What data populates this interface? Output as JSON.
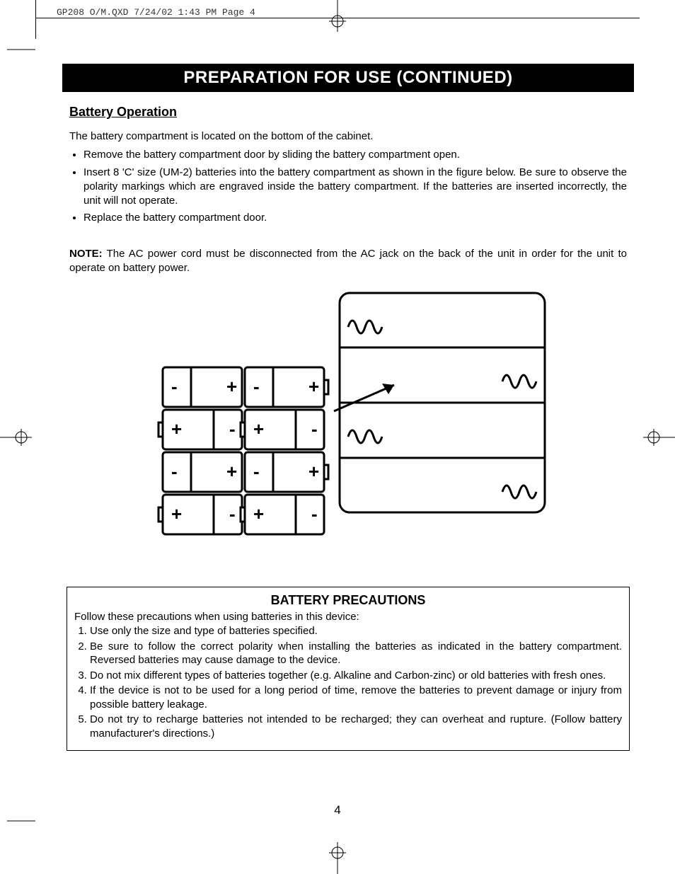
{
  "print_header": "GP208 O/M.QXD  7/24/02  1:43 PM  Page 4",
  "title": "PREPARATION FOR USE (CONTINUED)",
  "section_heading": "Battery Operation",
  "intro": "The battery compartment is located on the bottom of the cabinet.",
  "bullets": [
    "Remove the battery compartment door by sliding the battery compartment open.",
    "Insert 8 'C' size (UM-2) batteries into the battery compartment as shown in the figure below. Be sure to observe the polarity markings which are engraved inside the battery compartment. If the batteries are inserted incorrectly, the unit will not operate.",
    "Replace the battery compartment door."
  ],
  "note_label": "NOTE:",
  "note_text": " The AC power cord must be disconnected from the AC jack on the back of the unit in order for the unit to operate on battery power.",
  "precautions_title": "BATTERY PRECAUTIONS",
  "precautions_intro": "Follow these precautions when using batteries in this device:",
  "precautions": [
    "Use only the size and type of batteries specified.",
    "Be sure to follow the correct polarity when installing the batteries as indicated in the battery compartment. Reversed batteries may cause damage to the device.",
    "Do not mix different types of batteries together (e.g. Alkaline and Carbon-zinc) or old batteries with fresh ones.",
    "If the device is not to be used for a long period of time, remove the batteries to prevent damage or injury from possible battery leakage.",
    "Do not try to recharge batteries not intended to be recharged; they can overheat and rupture. (Follow battery manufacturer's directions.)"
  ],
  "page_number": "4"
}
